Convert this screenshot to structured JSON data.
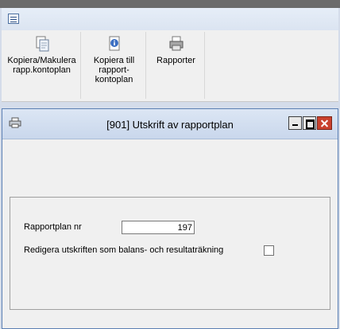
{
  "ribbon": {
    "buttons": [
      {
        "label": "Kopiera/Makulera\nrapp.kontoplan",
        "icon": "copy-document-icon"
      },
      {
        "label": "Kopiera till\nrapport-\nkontoplan",
        "icon": "info-document-icon"
      },
      {
        "label": "Rapporter",
        "icon": "printer-icon"
      }
    ]
  },
  "window": {
    "title": "[901]  Utskrift av rapportplan"
  },
  "form": {
    "plan_label": "Rapportplan nr",
    "plan_value": "197",
    "edit_label": "Redigera utskriften som balans- och resultaträkning",
    "edit_checked": false
  }
}
